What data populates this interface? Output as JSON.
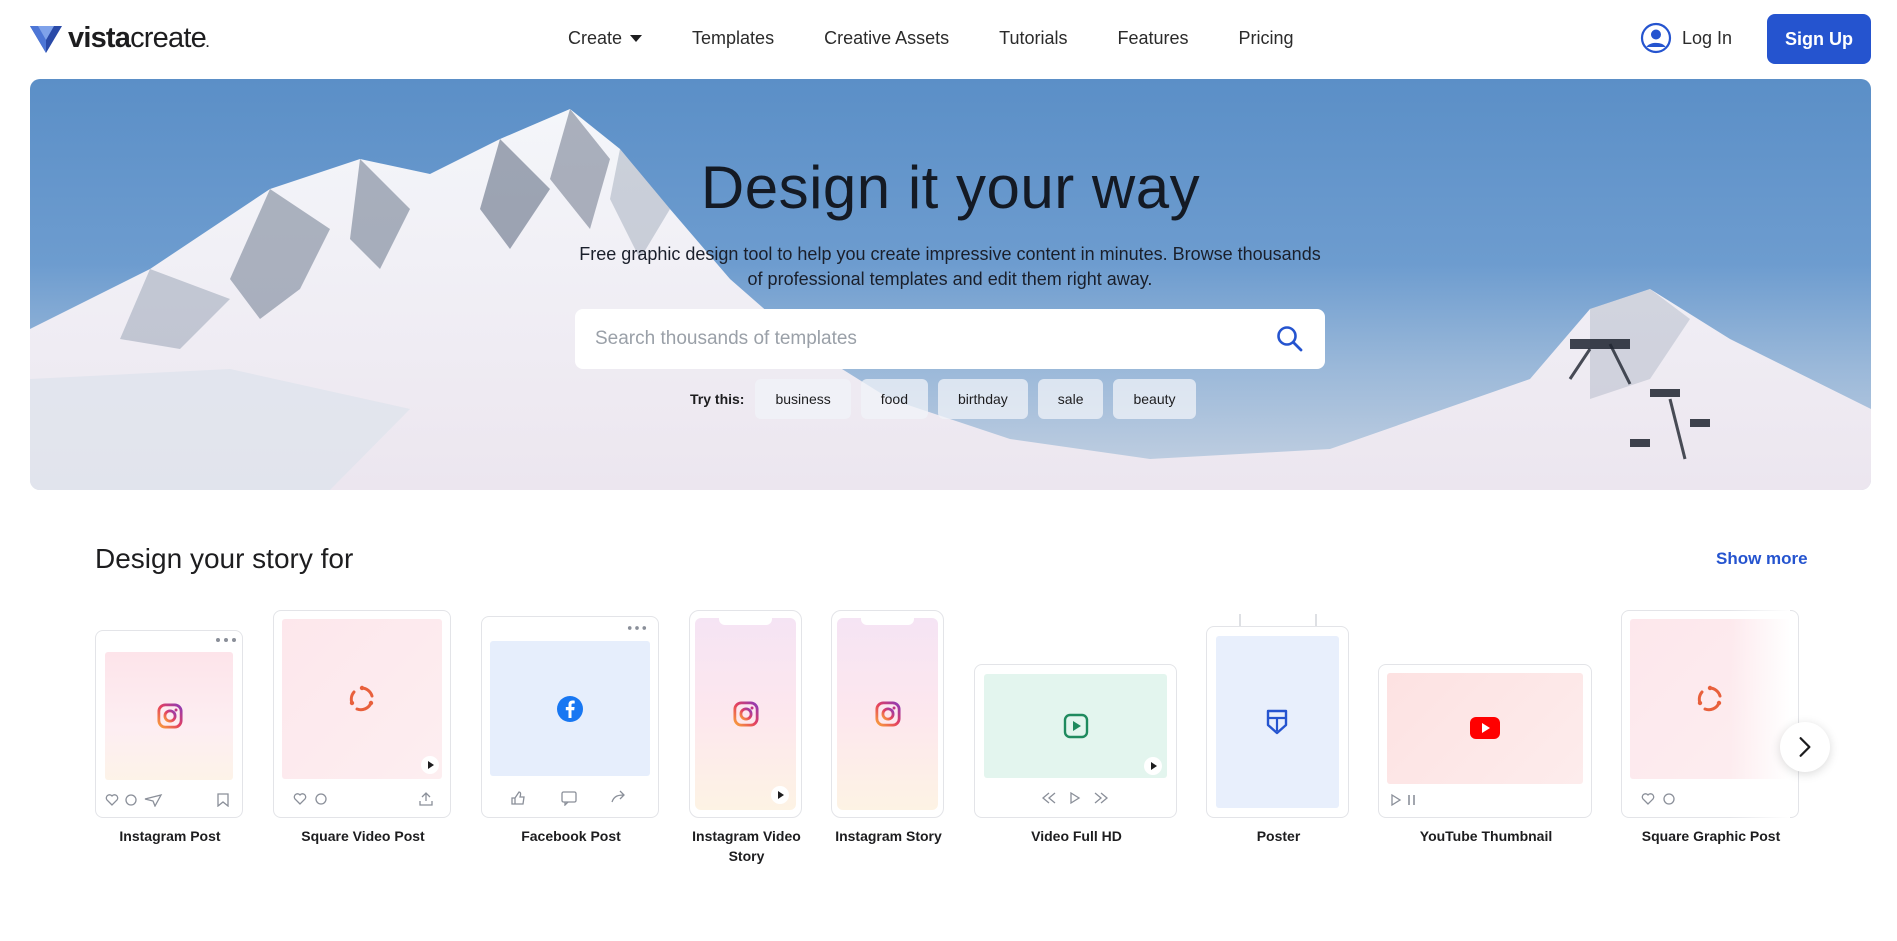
{
  "header": {
    "logo_bold": "vista",
    "logo_light": "create",
    "nav": [
      {
        "label": "Create",
        "has_dropdown": true
      },
      {
        "label": "Templates"
      },
      {
        "label": "Creative Assets"
      },
      {
        "label": "Tutorials"
      },
      {
        "label": "Features"
      },
      {
        "label": "Pricing"
      }
    ],
    "login_label": "Log In",
    "signup_label": "Sign Up"
  },
  "hero": {
    "title": "Design it your way",
    "subtitle": "Free graphic design tool to help you create impressive content in minutes. Browse thousands of professional templates and edit them right away.",
    "search_placeholder": "Search thousands of templates",
    "try_label": "Try this:",
    "suggestions": [
      "business",
      "food",
      "birthday",
      "sale",
      "beauty"
    ]
  },
  "section": {
    "title": "Design your story for",
    "show_more": "Show more"
  },
  "formats": [
    {
      "label": "Instagram Post",
      "icon": "instagram-icon"
    },
    {
      "label": "Square Video Post",
      "icon": "animation-icon"
    },
    {
      "label": "Facebook Post",
      "icon": "facebook-icon"
    },
    {
      "label": "Instagram Video Story",
      "icon": "instagram-icon"
    },
    {
      "label": "Instagram Story",
      "icon": "instagram-icon"
    },
    {
      "label": "Video Full HD",
      "icon": "play-icon"
    },
    {
      "label": "Poster",
      "icon": "poster-icon"
    },
    {
      "label": "YouTube Thumbnail",
      "icon": "youtube-icon"
    },
    {
      "label": "Square Graphic Post",
      "icon": "animation-icon"
    }
  ],
  "colors": {
    "brand_blue": "#2554cf",
    "instagram_gradient_start": "#fde4ea",
    "facebook_bg": "#e6eefc",
    "video_bg": "#e3f5ee",
    "youtube_red": "#ff0000"
  }
}
